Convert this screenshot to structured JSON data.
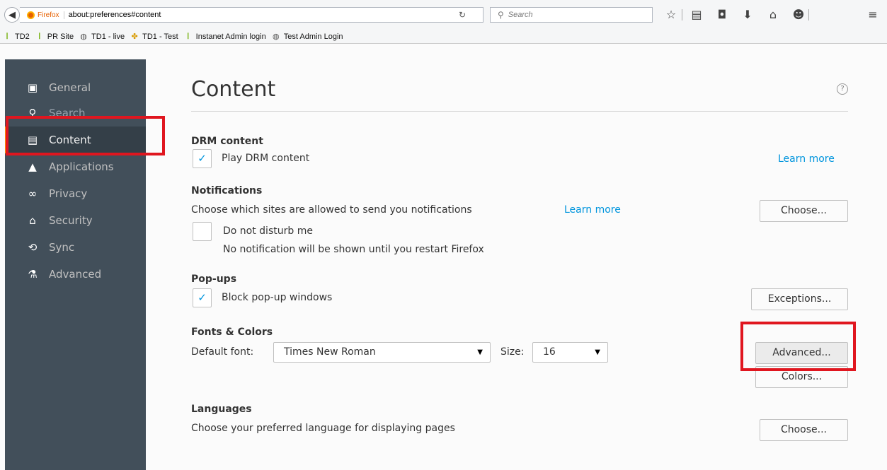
{
  "toolbar": {
    "brand": "Firefox",
    "url": "about:preferences#content",
    "search_placeholder": "Search"
  },
  "bookmarks": [
    {
      "label": "TD2",
      "icon": "leaf-icon"
    },
    {
      "label": "PR Site",
      "icon": "leaf-icon"
    },
    {
      "label": "TD1 - live",
      "icon": "globe-icon"
    },
    {
      "label": "TD1 - Test",
      "icon": "td-icon"
    },
    {
      "label": "Instanet Admin login",
      "icon": "leaf-icon"
    },
    {
      "label": "Test Admin Login",
      "icon": "globe-icon"
    }
  ],
  "sidebar": {
    "items": [
      {
        "label": "General",
        "icon": "general-icon"
      },
      {
        "label": "Search",
        "icon": "search-icon"
      },
      {
        "label": "Content",
        "icon": "content-icon",
        "selected": true
      },
      {
        "label": "Applications",
        "icon": "applications-icon"
      },
      {
        "label": "Privacy",
        "icon": "privacy-icon"
      },
      {
        "label": "Security",
        "icon": "security-icon"
      },
      {
        "label": "Sync",
        "icon": "sync-icon"
      },
      {
        "label": "Advanced",
        "icon": "advanced-icon"
      }
    ]
  },
  "content": {
    "title": "Content",
    "drm": {
      "heading": "DRM content",
      "checkbox_label": "Play DRM content",
      "checked": true,
      "learn_more": "Learn more"
    },
    "notifications": {
      "heading": "Notifications",
      "description": "Choose which sites are allowed to send you notifications",
      "learn_more": "Learn more",
      "choose_button": "Choose...",
      "dnd_label": "Do not disturb me",
      "dnd_checked": false,
      "dnd_note": "No notification will be shown until you restart Firefox"
    },
    "popups": {
      "heading": "Pop-ups",
      "checkbox_label": "Block pop-up windows",
      "checked": true,
      "exceptions_button": "Exceptions..."
    },
    "fonts": {
      "heading": "Fonts & Colors",
      "default_font_label": "Default font:",
      "default_font_value": "Times New Roman",
      "size_label": "Size:",
      "size_value": "16",
      "advanced_button": "Advanced...",
      "colors_button": "Colors..."
    },
    "languages": {
      "heading": "Languages",
      "description": "Choose your preferred language for displaying pages",
      "choose_button": "Choose..."
    }
  },
  "colors": {
    "sidebar_bg": "#424f5a",
    "selected_accent": "#ff9500",
    "link": "#0095dd",
    "highlight": "#e0161f"
  }
}
